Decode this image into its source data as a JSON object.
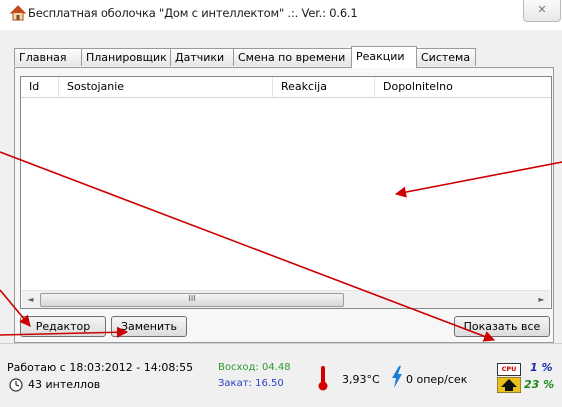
{
  "window": {
    "title": "Бесплатная оболочка \"Дом с интеллектом\" .:. Ver.: 0.6.1",
    "close_glyph": "✕"
  },
  "tabs": [
    {
      "label": "Главная"
    },
    {
      "label": "Планировщик"
    },
    {
      "label": "Датчики"
    },
    {
      "label": "Смена по времени"
    },
    {
      "label": "Реакции",
      "active": true
    },
    {
      "label": "Система"
    }
  ],
  "list": {
    "columns": [
      "Id",
      "Sostojanie",
      "Reakcija",
      "Dopolnitelno"
    ],
    "rows": []
  },
  "scrollbar": {
    "left_glyph": "◄",
    "right_glyph": "►",
    "thumb_grip": "III"
  },
  "buttons": {
    "editor": "Редактор",
    "replace": "Заменить",
    "show_all": "Показать все"
  },
  "status": {
    "uptime": "Работаю с 18:03:2012 - 14:08:55",
    "intels": "43 интеллов",
    "sunrise": "Восход: 04.48",
    "sunset": "Закат: 16.50",
    "temperature": "3,93°С",
    "ops": "0 опер/сек",
    "cpu_label": "CPU",
    "cpu_percent": "1 %",
    "mem_percent": "23 %"
  },
  "colors": {
    "sunrise": "#2e9a2e",
    "sunset": "#2a3fc8",
    "cpu_percent": "#1b2fa8",
    "mem_percent": "#1a8a1a",
    "annotation_arrows": "#cc0000",
    "thermometer": "#d40000"
  },
  "icons": [
    "house-icon",
    "close-icon",
    "clock-icon",
    "thermometer-icon",
    "lightning-icon",
    "cpu-icon",
    "memory-icon"
  ]
}
